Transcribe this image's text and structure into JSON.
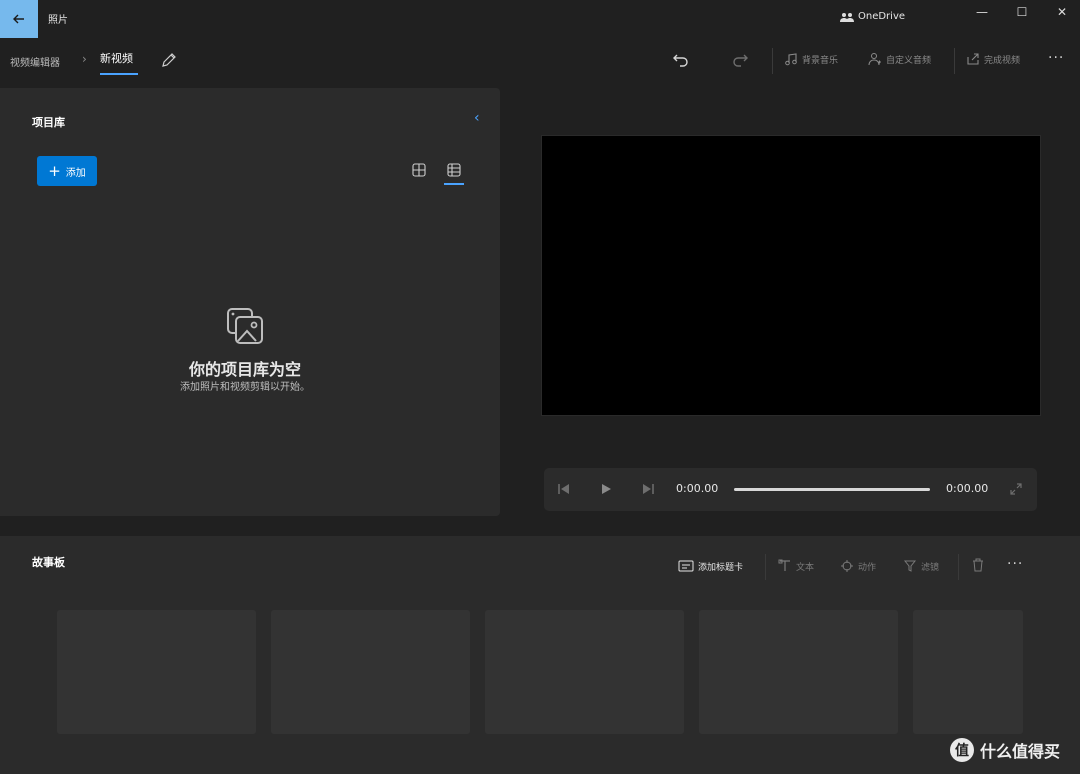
{
  "window": {
    "title": "照片",
    "onedrive_label": "OneDrive",
    "minimize_glyph": "—",
    "maximize_glyph": "☐",
    "close_glyph": "✕"
  },
  "breadcrumb": {
    "root": "视频编辑器",
    "separator": "›",
    "current": "新视频"
  },
  "toolbar": {
    "undo_icon": "undo-icon",
    "redo_icon": "redo-icon",
    "background_music": "背景音乐",
    "custom_audio": "自定义音频",
    "finish_video": "完成视频",
    "more": "···"
  },
  "library": {
    "title": "项目库",
    "add_label": "添加",
    "empty_title": "你的项目库为空",
    "empty_subtitle": "添加照片和视频剪辑以开始。"
  },
  "player": {
    "current_time": "0:00.00",
    "total_time": "0:00.00"
  },
  "storyboard": {
    "title": "故事板",
    "add_title_card": "添加标题卡",
    "text": "文本",
    "motion": "动作",
    "filters": "滤镜",
    "more": "···"
  },
  "watermark": {
    "logo": "值",
    "text": "什么值得买"
  },
  "colors": {
    "accent": "#0078d4",
    "back_button": "#76b9ed",
    "panel": "#2b2b2b",
    "background": "#202020"
  }
}
